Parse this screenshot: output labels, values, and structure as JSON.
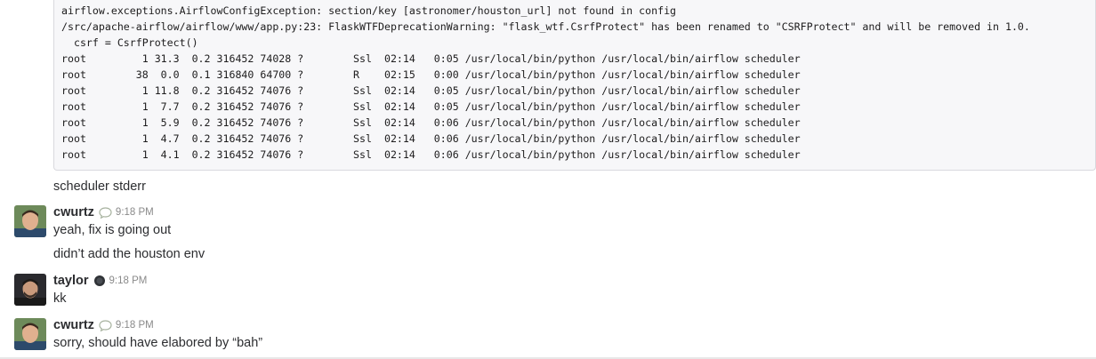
{
  "code_block": {
    "lines": [
      "airflow.exceptions.AirflowConfigException: section/key [astronomer/houston_url] not found in config",
      "/src/apache-airflow/airflow/www/app.py:23: FlaskWTFDeprecationWarning: \"flask_wtf.CsrfProtect\" has been renamed to \"CSRFProtect\" and will be removed in 1.0.",
      "  csrf = CsrfProtect()",
      "root         1 31.3  0.2 316452 74028 ?        Ssl  02:14   0:05 /usr/local/bin/python /usr/local/bin/airflow scheduler",
      "root        38  0.0  0.1 316840 64700 ?        R    02:15   0:00 /usr/local/bin/python /usr/local/bin/airflow scheduler",
      "root         1 11.8  0.2 316452 74076 ?        Ssl  02:14   0:05 /usr/local/bin/python /usr/local/bin/airflow scheduler",
      "root         1  7.7  0.2 316452 74076 ?        Ssl  02:14   0:05 /usr/local/bin/python /usr/local/bin/airflow scheduler",
      "root         1  5.9  0.2 316452 74076 ?        Ssl  02:14   0:06 /usr/local/bin/python /usr/local/bin/airflow scheduler",
      "root         1  4.7  0.2 316452 74076 ?        Ssl  02:14   0:06 /usr/local/bin/python /usr/local/bin/airflow scheduler",
      "root         1  4.1  0.2 316452 74076 ?        Ssl  02:14   0:06 /usr/local/bin/python /usr/local/bin/airflow scheduler"
    ]
  },
  "messages": [
    {
      "text": "scheduler stderr"
    },
    {
      "author": "cwurtz",
      "status_icon": "speech-bubble-icon",
      "time": "9:18 PM",
      "text": "yeah, fix is going out"
    },
    {
      "text": "didn’t add the houston env"
    },
    {
      "author": "taylor",
      "status_icon": "dark-circle-icon",
      "time": "9:18 PM",
      "text": "kk"
    },
    {
      "author": "cwurtz",
      "status_icon": "speech-bubble-icon",
      "time": "9:18 PM",
      "text": "sorry, should have elabored by “bah”"
    }
  ],
  "colors": {
    "code_background": "#f7f7f9",
    "code_border": "#d9d9de",
    "text": "#2c2d30",
    "timestamp": "#8a8a8a"
  }
}
